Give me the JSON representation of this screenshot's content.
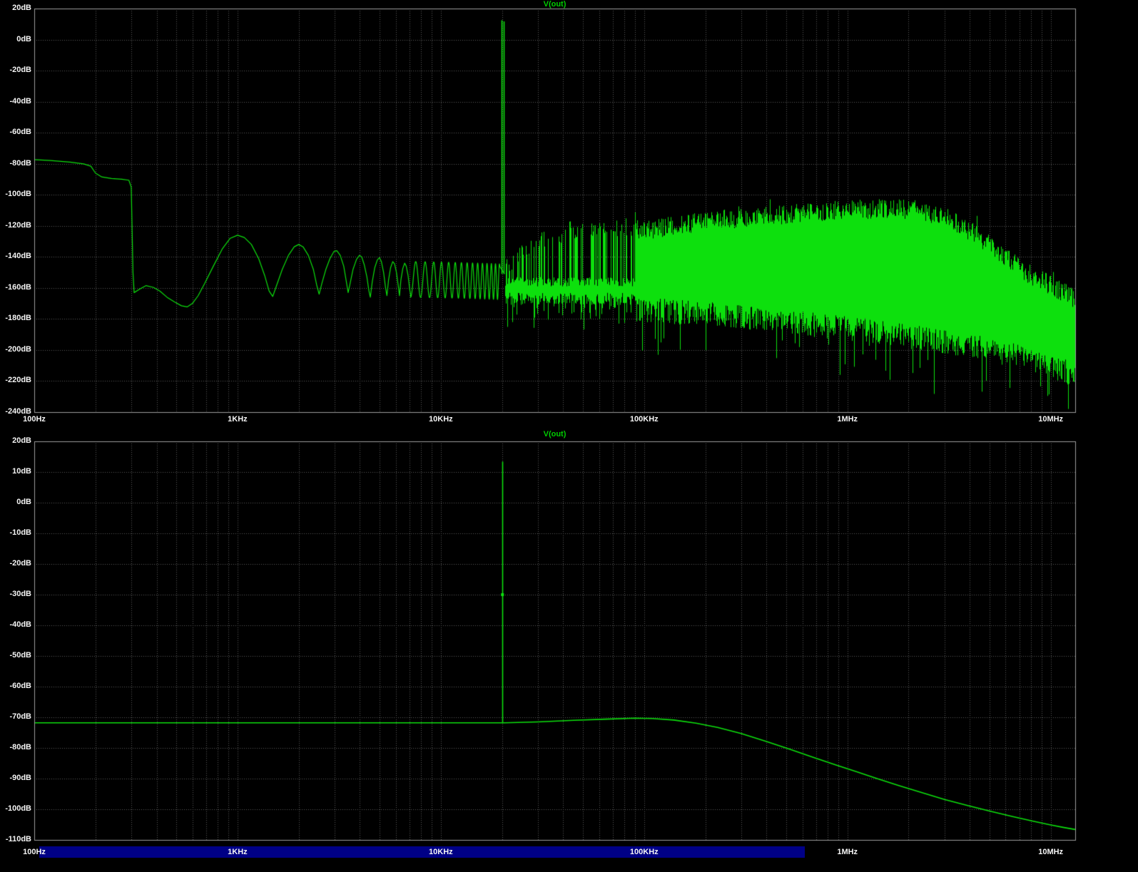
{
  "window": {
    "background": "#000000",
    "grid_color": "#5a5a5a",
    "border_color": "#9c9c9c",
    "axis_text_color": "#f5f5f5",
    "trace_color": "#0de00d",
    "title_color": "#00cc00",
    "selection_color": "#000086"
  },
  "selection_bar": {
    "visible": true
  },
  "chart_data": [
    {
      "type": "line",
      "title": "V(out)",
      "x_scale": "log",
      "x_unit": "Hz",
      "x_range": [
        100,
        13200000
      ],
      "x_ticks": [
        {
          "value": 100,
          "label": "100Hz"
        },
        {
          "value": 1000,
          "label": "1KHz"
        },
        {
          "value": 10000,
          "label": "10KHz"
        },
        {
          "value": 100000,
          "label": "100KHz"
        },
        {
          "value": 1000000,
          "label": "1MHz"
        },
        {
          "value": 10000000,
          "label": "10MHz"
        }
      ],
      "ylim": [
        -240,
        20
      ],
      "y_ticks": [
        {
          "value": 20,
          "label": "20dB"
        },
        {
          "value": 0,
          "label": "0dB"
        },
        {
          "value": -20,
          "label": "-20dB"
        },
        {
          "value": -40,
          "label": "-40dB"
        },
        {
          "value": -60,
          "label": "-60dB"
        },
        {
          "value": -80,
          "label": "-80dB"
        },
        {
          "value": -100,
          "label": "-100dB"
        },
        {
          "value": -120,
          "label": "-120dB"
        },
        {
          "value": -140,
          "label": "-140dB"
        },
        {
          "value": -160,
          "label": "-160dB"
        },
        {
          "value": -180,
          "label": "-180dB"
        },
        {
          "value": -200,
          "label": "-200dB"
        },
        {
          "value": -220,
          "label": "-220dB"
        },
        {
          "value": -240,
          "label": "-240dB"
        }
      ],
      "grid": true,
      "spike": {
        "base_db": -151,
        "lines": [
          [
            19870,
            12.4
          ],
          [
            20360,
            11.7
          ]
        ]
      },
      "trace_polyline": [
        [
          100,
          -77.3
        ],
        [
          120,
          -77.9
        ],
        [
          150,
          -78.9
        ],
        [
          175,
          -80.1
        ],
        [
          190,
          -81.6
        ],
        [
          200,
          -86.0
        ],
        [
          215,
          -88.5
        ],
        [
          240,
          -89.5
        ],
        [
          270,
          -90.0
        ],
        [
          292,
          -90.6
        ],
        [
          300,
          -95.0
        ],
        [
          306,
          -150.0
        ],
        [
          310,
          -163.0
        ],
        [
          330,
          -160.8
        ],
        [
          355,
          -158.5
        ],
        [
          385,
          -159.6
        ],
        [
          415,
          -162.0
        ],
        [
          450,
          -166.0
        ],
        [
          490,
          -169.0
        ],
        [
          530,
          -171.5
        ],
        [
          565,
          -172.2
        ],
        [
          600,
          -170.0
        ],
        [
          640,
          -165.0
        ],
        [
          690,
          -157.0
        ],
        [
          760,
          -146.0
        ],
        [
          840,
          -135.0
        ],
        [
          920,
          -128.0
        ],
        [
          1000,
          -126.0
        ],
        [
          1080,
          -127.5
        ],
        [
          1170,
          -132.0
        ],
        [
          1270,
          -141.0
        ],
        [
          1360,
          -152.0
        ],
        [
          1430,
          -162.0
        ],
        [
          1490,
          -165.5
        ],
        [
          1560,
          -158.0
        ],
        [
          1660,
          -148.0
        ],
        [
          1780,
          -139.0
        ],
        [
          1900,
          -133.5
        ],
        [
          2000,
          -132.0
        ],
        [
          2100,
          -133.5
        ],
        [
          2230,
          -139.0
        ],
        [
          2360,
          -148.0
        ],
        [
          2450,
          -158.0
        ],
        [
          2520,
          -164.0
        ],
        [
          2600,
          -157.0
        ],
        [
          2720,
          -148.0
        ],
        [
          2850,
          -141.0
        ],
        [
          2980,
          -136.5
        ],
        [
          3080,
          -136.0
        ],
        [
          3200,
          -139.0
        ],
        [
          3330,
          -146.0
        ],
        [
          3430,
          -156.0
        ],
        [
          3500,
          -163.0
        ],
        [
          3580,
          -157.0
        ],
        [
          3700,
          -148.0
        ],
        [
          3850,
          -141.5
        ],
        [
          3980,
          -139.0
        ],
        [
          4080,
          -140.0
        ],
        [
          4200,
          -145.0
        ],
        [
          4330,
          -153.0
        ],
        [
          4430,
          -162.0
        ],
        [
          4500,
          -166.0
        ],
        [
          4600,
          -156.0
        ],
        [
          4730,
          -147.0
        ],
        [
          4870,
          -142.0
        ],
        [
          4990,
          -140.5
        ],
        [
          5100,
          -143.0
        ],
        [
          5230,
          -150.0
        ],
        [
          5350,
          -160.0
        ],
        [
          5430,
          -165.0
        ],
        [
          5530,
          -155.0
        ],
        [
          5660,
          -147.0
        ],
        [
          5800,
          -143.0
        ],
        [
          5920,
          -144.5
        ],
        [
          6050,
          -150.0
        ],
        [
          6180,
          -159.0
        ],
        [
          6260,
          -165.0
        ],
        [
          6360,
          -155.0
        ],
        [
          6500,
          -147.5
        ],
        [
          6640,
          -144.0
        ],
        [
          6760,
          -146.0
        ],
        [
          6900,
          -152.0
        ],
        [
          7030,
          -161.0
        ],
        [
          7100,
          -164.0
        ]
      ],
      "oscillation": {
        "from_hz": 7100,
        "to_hz": 19500,
        "spacing_hz": 850,
        "mid_db": -154.5,
        "amp_db": 11.5,
        "drift_db": -1.5
      },
      "noise": {
        "start_hz": 20600,
        "comb_end_hz": 90000,
        "floor_top_db": -156,
        "floor_bottom_db": -167,
        "envelope": [
          [
            20600,
            -149,
            -168
          ],
          [
            23000,
            -141,
            -170
          ],
          [
            26000,
            -136,
            -171
          ],
          [
            30000,
            -131,
            -172
          ],
          [
            36000,
            -127,
            -172
          ],
          [
            43000,
            -123,
            -173
          ],
          [
            52000,
            -121,
            -173
          ],
          [
            65000,
            -120,
            -174
          ],
          [
            80000,
            -121,
            -175
          ],
          [
            100000,
            -122,
            -176
          ],
          [
            130000,
            -119,
            -177
          ],
          [
            170000,
            -117,
            -178
          ],
          [
            220000,
            -115,
            -179
          ],
          [
            290000,
            -113.5,
            -181
          ],
          [
            380000,
            -112,
            -182
          ],
          [
            500000,
            -111,
            -184
          ],
          [
            700000,
            -109.5,
            -186
          ],
          [
            950000,
            -108.5,
            -188
          ],
          [
            1300000,
            -107.5,
            -190
          ],
          [
            1700000,
            -107.5,
            -192
          ],
          [
            2200000,
            -108.5,
            -194
          ],
          [
            2800000,
            -111,
            -196
          ],
          [
            3500000,
            -117,
            -198
          ],
          [
            4300000,
            -124,
            -200
          ],
          [
            5200000,
            -132,
            -202
          ],
          [
            6200000,
            -140,
            -205
          ],
          [
            7300000,
            -147,
            -207
          ],
          [
            8500000,
            -152,
            -209
          ],
          [
            10000000,
            -157,
            -212
          ],
          [
            11500000,
            -161,
            -215
          ],
          [
            13200000,
            -166,
            -218
          ]
        ]
      }
    },
    {
      "type": "line",
      "title": "V(out)",
      "x_scale": "log",
      "x_unit": "Hz",
      "x_range": [
        100,
        13200000
      ],
      "x_ticks": [
        {
          "value": 100,
          "label": "100Hz"
        },
        {
          "value": 1000,
          "label": "1KHz"
        },
        {
          "value": 10000,
          "label": "10KHz"
        },
        {
          "value": 100000,
          "label": "100KHz"
        },
        {
          "value": 1000000,
          "label": "1MHz"
        },
        {
          "value": 10000000,
          "label": "10MHz"
        }
      ],
      "ylim": [
        -110,
        20
      ],
      "y_ticks": [
        {
          "value": 20,
          "label": "20dB"
        },
        {
          "value": 10,
          "label": "10dB"
        },
        {
          "value": 0,
          "label": "0dB"
        },
        {
          "value": -10,
          "label": "-10dB"
        },
        {
          "value": -20,
          "label": "-20dB"
        },
        {
          "value": -30,
          "label": "-30dB"
        },
        {
          "value": -40,
          "label": "-40dB"
        },
        {
          "value": -50,
          "label": "-50dB"
        },
        {
          "value": -60,
          "label": "-60dB"
        },
        {
          "value": -70,
          "label": "-70dB"
        },
        {
          "value": -80,
          "label": "-80dB"
        },
        {
          "value": -90,
          "label": "-90dB"
        },
        {
          "value": -100,
          "label": "-100dB"
        },
        {
          "value": -110,
          "label": "-110dB"
        }
      ],
      "grid": true,
      "spike": {
        "base_db": -71.8,
        "lines": [
          [
            20100,
            13.4
          ]
        ],
        "marker_db": -30
      },
      "trace_polyline": [
        [
          100,
          -71.8
        ],
        [
          300,
          -71.8
        ],
        [
          1000,
          -71.8
        ],
        [
          3000,
          -71.8
        ],
        [
          10000,
          -71.8
        ],
        [
          20600,
          -71.8
        ],
        [
          30000,
          -71.5
        ],
        [
          45000,
          -71.0
        ],
        [
          65000,
          -70.6
        ],
        [
          90000,
          -70.3
        ],
        [
          110000,
          -70.4
        ],
        [
          140000,
          -70.9
        ],
        [
          180000,
          -71.9
        ],
        [
          230000,
          -73.3
        ],
        [
          300000,
          -75.3
        ],
        [
          400000,
          -77.9
        ],
        [
          520000,
          -80.4
        ],
        [
          680000,
          -83.1
        ],
        [
          880000,
          -85.6
        ],
        [
          1100000,
          -87.7
        ],
        [
          1400000,
          -90.0
        ],
        [
          1800000,
          -92.3
        ],
        [
          2300000,
          -94.5
        ],
        [
          3000000,
          -96.8
        ],
        [
          3900000,
          -98.8
        ],
        [
          5000000,
          -100.6
        ],
        [
          6500000,
          -102.4
        ],
        [
          8200000,
          -103.9
        ],
        [
          10000000,
          -105.1
        ],
        [
          11500000,
          -105.9
        ],
        [
          13200000,
          -106.6
        ]
      ]
    }
  ]
}
